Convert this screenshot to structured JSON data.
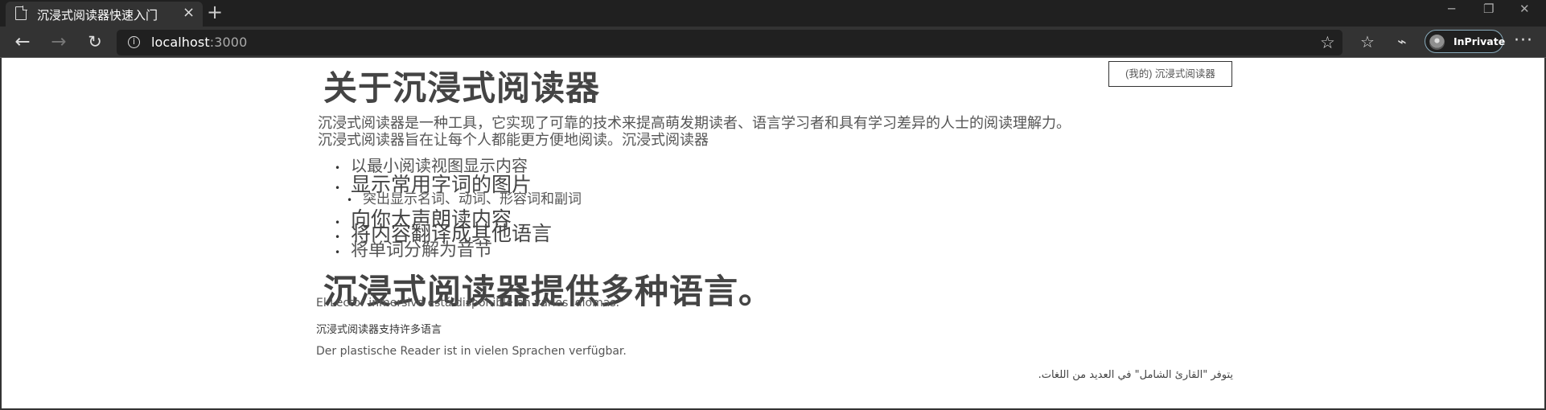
{
  "browser": {
    "tab_title": "沉浸式阅读器快速入门",
    "tab_close": "×",
    "new_tab": "+",
    "url_host": "localhost",
    "url_port": ":3000",
    "inprivate_label": "InPrivate",
    "more": "···",
    "colors": {
      "chrome_dark": "#202020",
      "toolbar": "#333333",
      "accent": "#8ab"
    }
  },
  "page": {
    "reader_button": "(我的) 沉浸式阅读器",
    "heading_1": "关于沉浸式阅读器",
    "paragraph_1": "沉浸式阅读器是一种工具，它实现了可靠的技术来提高萌发期读者、语言学习者和具有学习差异的人士的阅读理解力。",
    "paragraph_2": "沉浸式阅读器旨在让每个人都能更方便地阅读。沉浸式阅读器",
    "features": [
      "以最小阅读视图显示内容",
      "显示常用字词的图片",
      "突出显示名词、动词、形容词和副词",
      "向你大声朗读内容",
      "将内容翻译成其他语言",
      "将单词分解为音节"
    ],
    "heading_2": "沉浸式阅读器提供多种语言。",
    "spanish": "El Lector inmersivo está disponible en varios idiomas.",
    "chinese": "沉浸式阅读器支持许多语言",
    "german": "Der plastische Reader ist in vielen Sprachen verfügbar.",
    "arabic": "يتوفر \"القارئ الشامل\" في العديد من اللغات."
  }
}
